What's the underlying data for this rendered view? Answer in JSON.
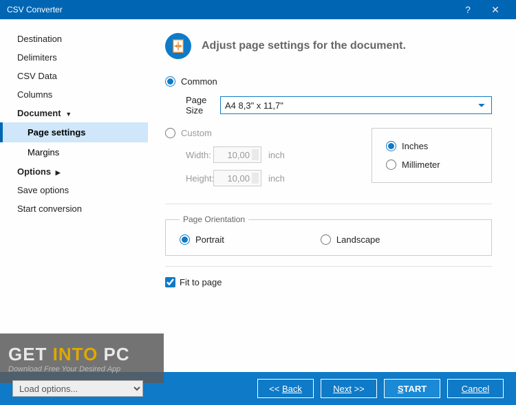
{
  "titlebar": {
    "title": "CSV Converter"
  },
  "sidebar": {
    "items": [
      {
        "label": "Destination"
      },
      {
        "label": "Delimiters"
      },
      {
        "label": "CSV Data"
      },
      {
        "label": "Columns"
      }
    ],
    "document_label": "Document",
    "subitems": [
      {
        "label": "Page settings"
      },
      {
        "label": "Margins"
      }
    ],
    "options_label": "Options",
    "trailing": [
      {
        "label": "Save options"
      },
      {
        "label": "Start conversion"
      }
    ]
  },
  "header": {
    "text": "Adjust page settings for the document."
  },
  "common": {
    "label": "Common",
    "page_size_label": "Page Size",
    "page_size_value": "A4 8,3\" x 11,7\""
  },
  "custom": {
    "label": "Custom",
    "width_label": "Width:",
    "width_value": "10,00",
    "height_label": "Height:",
    "height_value": "10,00",
    "unit_suffix": "inch",
    "unit_options": {
      "inches": "Inches",
      "mm": "Millimeter"
    }
  },
  "orientation": {
    "legend": "Page Orientation",
    "portrait": "Portrait",
    "landscape": "Landscape"
  },
  "fit": {
    "label": "Fit to page"
  },
  "footer": {
    "load_options": "Load options...",
    "back": "Back",
    "next": "Next",
    "start": "START",
    "cancel": "Cancel"
  },
  "watermark": {
    "line1a": "GET ",
    "line1b": "INTO ",
    "line1c": "PC",
    "line2": "Download Free Your Desired App"
  }
}
